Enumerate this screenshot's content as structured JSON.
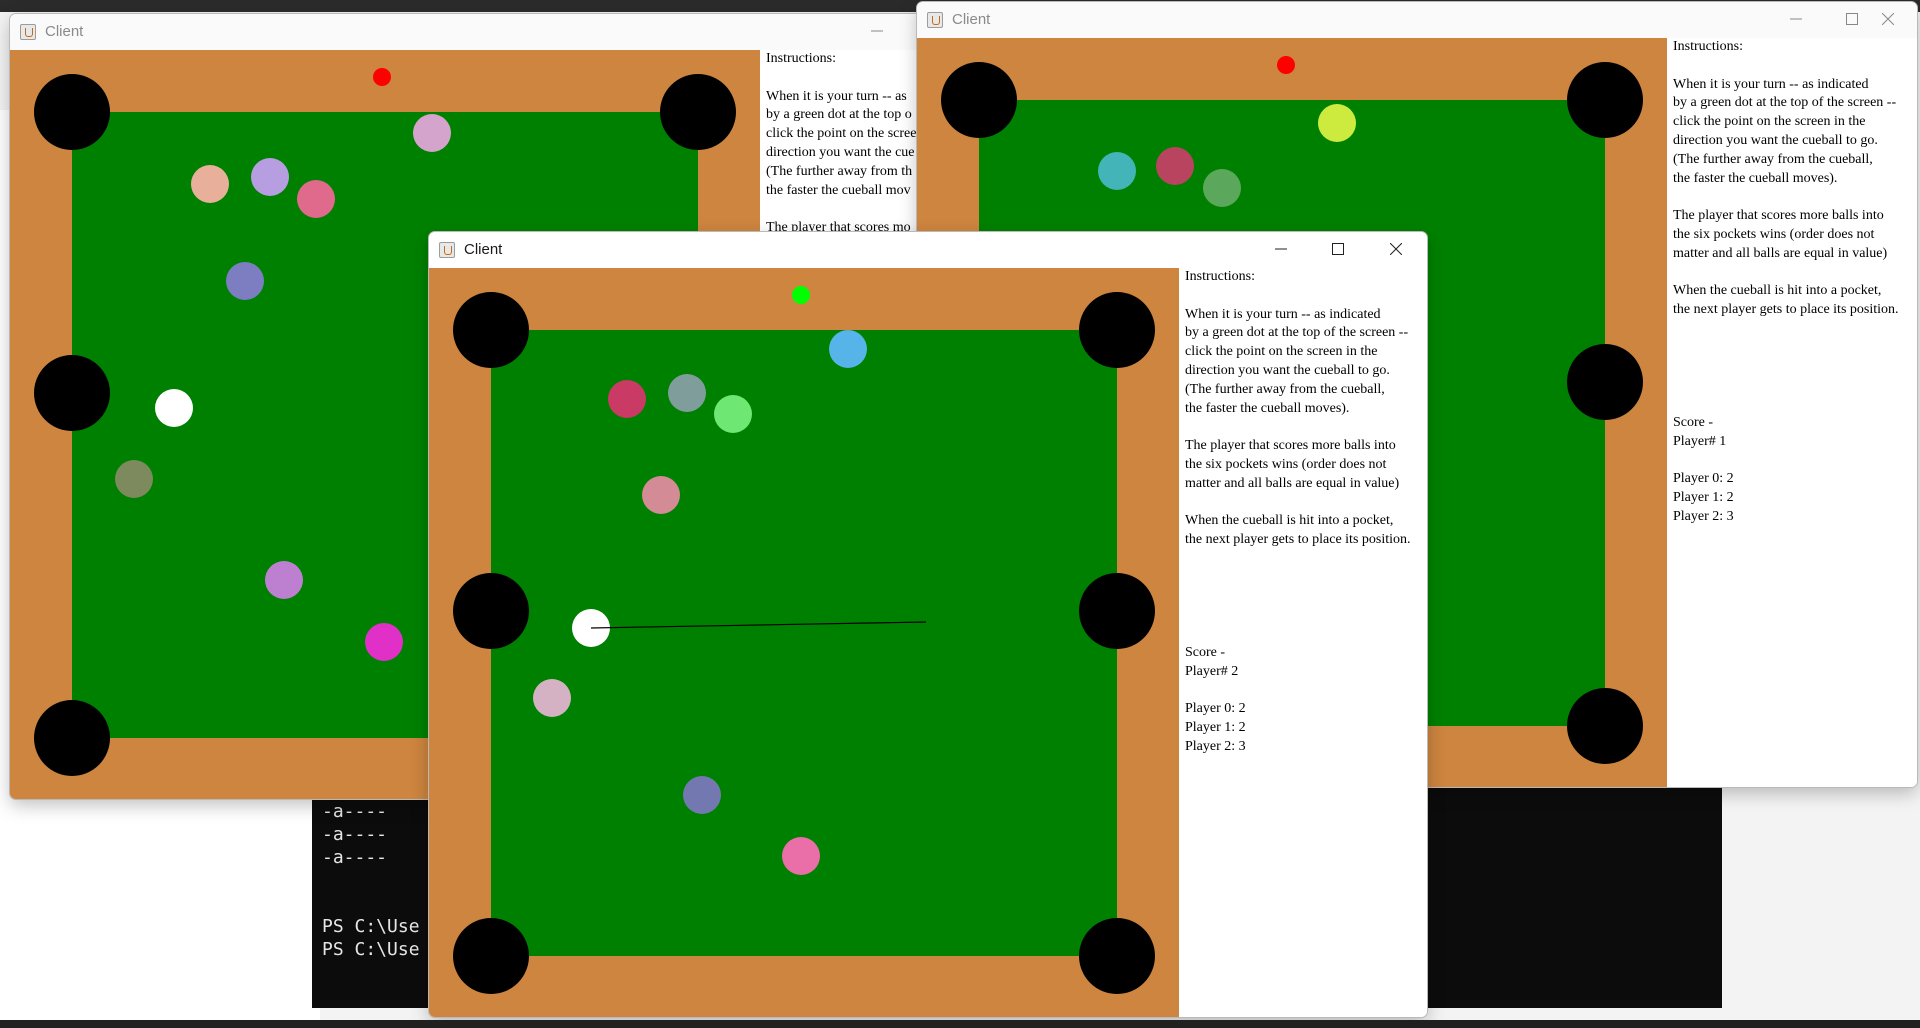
{
  "instructions": {
    "heading": "Instructions:",
    "p1": [
      "When it is your turn -- as indicated",
      "by a green dot at the top of the screen --",
      "click the point on the screen in the",
      "direction you want the cueball to go.",
      "(The further away from the cueball,",
      "the faster the cueball moves)."
    ],
    "p2": [
      "The player that scores more balls into",
      "the six pockets wins (order does not",
      "matter and all balls are equal in value)"
    ],
    "p3": [
      "When the cueball is hit into a pocket,",
      "the next player gets to place its position."
    ]
  },
  "colors": {
    "rail": "#cd853f",
    "felt": "#008000",
    "pocket": "#000000",
    "turn_active": "#00ff00",
    "turn_waiting": "#ff0000",
    "cueball": "#ffffff"
  },
  "terminal": {
    "lines": [
      "-a----",
      "-a----",
      "-a----",
      "",
      "",
      "PS C:\\Use",
      "PS C:\\Use"
    ]
  },
  "windows": {
    "left": {
      "title": "Client",
      "turn_indicator": "red",
      "instructions_visible": {
        "heading": "Instructions:",
        "p1": [
          "When it is your turn -- as",
          "by a green dot at the top o",
          "click the point on the scree",
          "direction you want the cue",
          "(The further away from th",
          "the faster the cueball mov"
        ],
        "p2_first": "The player that scores mo"
      },
      "balls": [
        {
          "color": "#e8b09a"
        },
        {
          "color": "#b69ee0"
        },
        {
          "color": "#e06a8c"
        },
        {
          "color": "#d5a4cc"
        },
        {
          "color": "#7d7dc2"
        },
        {
          "color": "#ffffff"
        },
        {
          "color": "#7c8a5e"
        },
        {
          "color": "#bd7fd0"
        },
        {
          "color": "#e030c8"
        }
      ]
    },
    "right": {
      "title": "Client",
      "turn_indicator": "red",
      "score": {
        "heading": "Score -",
        "player_label": "Player# 1",
        "lines": [
          "Player 0: 2",
          "Player 1: 2",
          "Player 2: 3"
        ]
      },
      "balls": [
        {
          "color": "#cceb3e"
        },
        {
          "color": "#43b4b8"
        },
        {
          "color": "#b94460"
        },
        {
          "color": "#5ba85c"
        }
      ]
    },
    "front": {
      "title": "Client",
      "turn_indicator": "green",
      "score": {
        "heading": "Score -",
        "player_label": "Player# 2",
        "lines": [
          "Player 0: 2",
          "Player 1: 2",
          "Player 2: 3"
        ]
      },
      "balls": [
        {
          "color": "#56b4e8"
        },
        {
          "color": "#c93a64"
        },
        {
          "color": "#7f9d9a"
        },
        {
          "color": "#6ee873"
        },
        {
          "color": "#d38b95"
        },
        {
          "color": "#ffffff"
        },
        {
          "color": "#d4b2c4"
        },
        {
          "color": "#7478b0"
        },
        {
          "color": "#ea6ea8"
        }
      ]
    }
  }
}
